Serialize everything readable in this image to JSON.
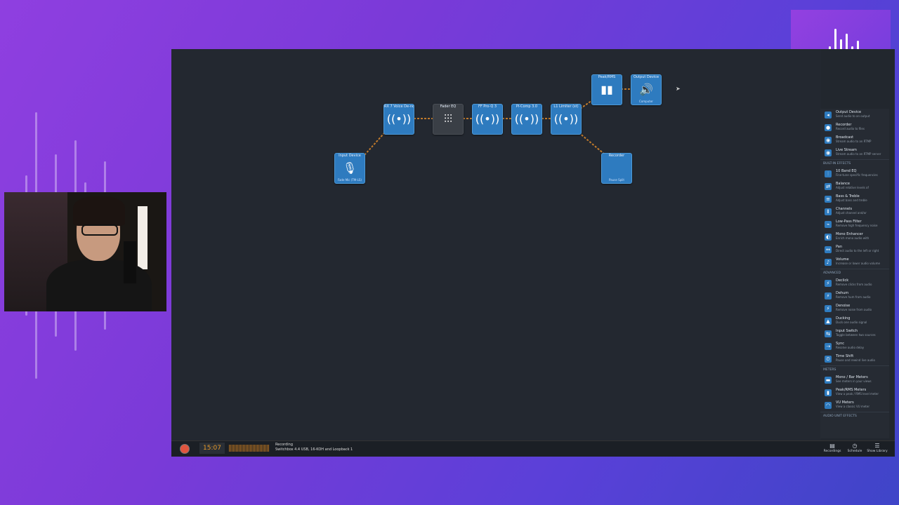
{
  "canvas": {
    "nodes": [
      {
        "id": "input",
        "title": "Input Device",
        "icon": "microphone-icon",
        "glyph": "🎙",
        "sub": "Fade Mic (TM-LS)"
      },
      {
        "id": "rx7",
        "title": "RX 7 Voice De-noise",
        "icon": "broadcast-icon",
        "glyph": "((•))",
        "sub": ""
      },
      {
        "id": "eq",
        "title": "Fader EQ",
        "icon": "sliders-icon",
        "glyph": "⫶⫶⫶",
        "sub": ""
      },
      {
        "id": "ffpro",
        "title": "FF Pro-Q 3",
        "icon": "broadcast-icon",
        "glyph": "((•))",
        "sub": ""
      },
      {
        "id": "comp",
        "title": "Pi-Comp 3.0",
        "icon": "broadcast-icon",
        "glyph": "((•))",
        "sub": ""
      },
      {
        "id": "limiter",
        "title": "L1 Limiter (st)",
        "icon": "broadcast-icon",
        "glyph": "((•))",
        "sub": ""
      },
      {
        "id": "peak",
        "title": "Peak/RMS",
        "icon": "meter-icon",
        "glyph": "▮▮",
        "sub": ""
      },
      {
        "id": "output",
        "title": "Output Device",
        "icon": "speaker-icon",
        "glyph": "🔊",
        "sub": "Computer"
      },
      {
        "id": "recorder",
        "title": "Recorder",
        "icon": "record-icon",
        "glyph": "",
        "sub": "Pause   Split"
      }
    ]
  },
  "bottom_bar": {
    "timer": "15:07",
    "rec_title": "Recording",
    "rec_detail": "Switchbox 4.4 USB, 16-KOH and Loopback 1",
    "buttons": [
      {
        "label": "Recordings",
        "glyph": "▤"
      },
      {
        "label": "Schedule",
        "glyph": "◷"
      },
      {
        "label": "Show Library",
        "glyph": "☰"
      }
    ]
  },
  "sidebar": {
    "top_items": [
      {
        "name": "Output Device",
        "desc": "Send audio to an output",
        "glyph": "◂"
      },
      {
        "name": "Recorder",
        "desc": "Record audio to files",
        "glyph": "●"
      },
      {
        "name": "Broadcast",
        "desc": "Stream audio to an RTMP",
        "glyph": "◉"
      },
      {
        "name": "Live Stream",
        "desc": "Stream audio to an RTMP server",
        "glyph": "◉"
      }
    ],
    "effects_title": "BUILT-IN EFFECTS",
    "effects": [
      {
        "name": "10 Band EQ",
        "desc": "Fine-tune specific frequencies",
        "glyph": "⫶"
      },
      {
        "name": "Balance",
        "desc": "Adjust relative levels of",
        "glyph": "⇄"
      },
      {
        "name": "Bass & Treble",
        "desc": "Adjust bass and treble",
        "glyph": "≡"
      },
      {
        "name": "Channels",
        "desc": "Adjust channel and/or",
        "glyph": "⫴"
      },
      {
        "name": "Low-Pass Filter",
        "desc": "Remove high frequency noise",
        "glyph": "⌁"
      },
      {
        "name": "Mono Enhancer",
        "desc": "Enrich mono audio with",
        "glyph": "◐"
      },
      {
        "name": "Pan",
        "desc": "Direct audio to the left or right",
        "glyph": "↔"
      },
      {
        "name": "Volume",
        "desc": "Increase or lower audio volume",
        "glyph": "♪"
      }
    ],
    "advanced_title": "ADVANCED",
    "advanced": [
      {
        "name": "Declick",
        "desc": "Remove clicks from audio",
        "glyph": "⚡"
      },
      {
        "name": "Dehum",
        "desc": "Remove hum from audio",
        "glyph": "⚡"
      },
      {
        "name": "Denoise",
        "desc": "Remove noise from audio",
        "glyph": "⚡"
      },
      {
        "name": "Ducking",
        "desc": "Duck one audio signal",
        "glyph": "▲"
      },
      {
        "name": "Input Switch",
        "desc": "Toggle between two sources",
        "glyph": "⇆"
      },
      {
        "name": "Sync",
        "desc": "Resolve audio delay",
        "glyph": "⇢"
      },
      {
        "name": "Time Shift",
        "desc": "Pause and rewind live audio",
        "glyph": "⏲"
      }
    ],
    "meters_title": "METERS",
    "meters": [
      {
        "name": "Mono / Bar Meters",
        "desc": "See meters in your views",
        "glyph": "▬"
      },
      {
        "name": "Peak/RMS Meters",
        "desc": "View a peak / RMS level meter",
        "glyph": "▮"
      },
      {
        "name": "VU Meters",
        "desc": "View a classic VU meter",
        "glyph": "◠"
      }
    ],
    "audio_units_title": "AUDIO UNIT EFFECTS"
  }
}
